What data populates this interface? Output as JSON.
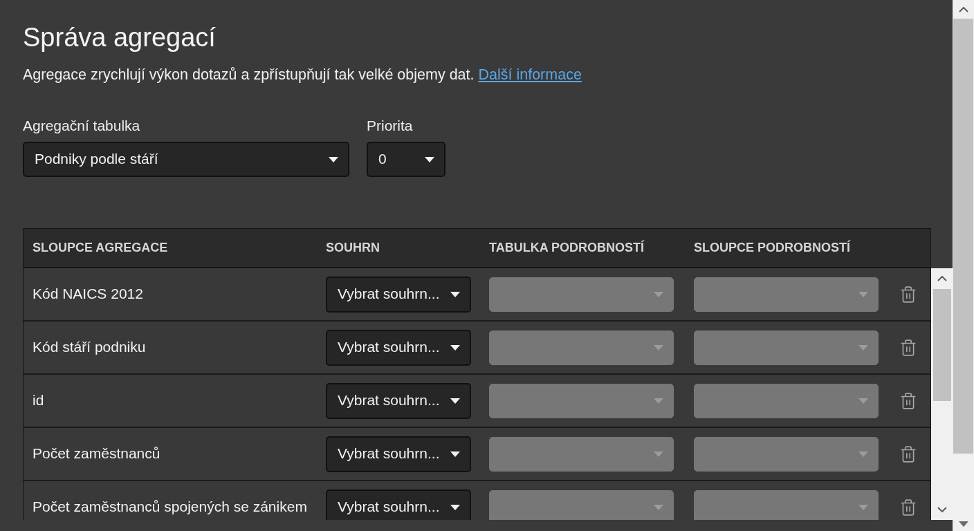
{
  "page": {
    "title": "Správa agregací",
    "description": "Agregace zrychlují výkon dotazů a zpřístupňují tak velké objemy dat.",
    "link": "Další informace"
  },
  "fields": [
    {
      "label": "Agregační tabulka",
      "value": "Podniky podle stáří"
    },
    {
      "label": "Priorita",
      "value": "0"
    }
  ],
  "table": {
    "columns": [
      "SLOUPCE AGREGACE",
      "SOUHRN",
      "TABULKA PODROBNOSTÍ",
      "SLOUPCE PODROBNOSTÍ"
    ],
    "rows": [
      {
        "column": "Kód NAICS 2012",
        "summary": {
          "value": "Vybrat souhrn...",
          "disabled": false
        },
        "detail_table": {
          "disabled": true
        },
        "detail_columns": {
          "disabled": true
        }
      },
      {
        "column": "Kód stáří podniku",
        "summary": {
          "value": "Vybrat souhrn...",
          "disabled": false
        },
        "detail_table": {
          "disabled": true
        },
        "detail_columns": {
          "disabled": true
        }
      },
      {
        "column": "id",
        "summary": {
          "value": "Vybrat souhrn...",
          "disabled": false
        },
        "detail_table": {
          "disabled": true
        },
        "detail_columns": {
          "disabled": true
        }
      },
      {
        "column": "Počet zaměstnanců",
        "summary": {
          "value": "Vybrat souhrn...",
          "disabled": false
        },
        "detail_table": {
          "disabled": true
        },
        "detail_columns": {
          "disabled": true
        }
      },
      {
        "column": "Počet zaměstnanců spojených se zánikem",
        "summary": {
          "value": "Vybrat souhrn...",
          "disabled": false
        },
        "detail_table": {
          "disabled": true
        },
        "detail_columns": {
          "disabled": true
        }
      }
    ]
  }
}
